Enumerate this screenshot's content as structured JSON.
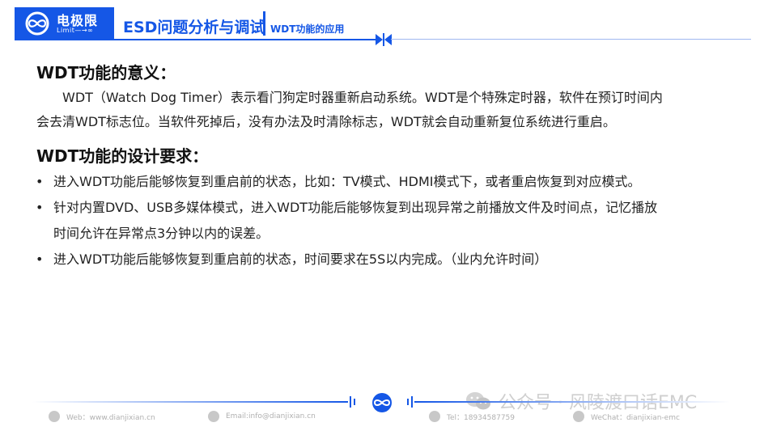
{
  "header": {
    "logo_cn": "电极限",
    "logo_en": "Limit—→∞",
    "title": "ESD问题分析与调试",
    "subtitle": "WDT功能的应用"
  },
  "content": {
    "heading1": "WDT功能的意义：",
    "para_line1": "WDT（Watch Dog Timer）表示看门狗定时器重新启动系统。WDT是个特殊定时器，软件在预订时间内",
    "para_line2": "会去清WDT标志位。当软件死掉后，没有办法及时清除标志，WDT就会自动重新复位系统进行重启。",
    "heading2": "WDT功能的设计要求：",
    "bullets": [
      {
        "dot": "•",
        "lines": [
          "进入WDT功能后能够恢复到重启前的状态，比如：TV模式、HDMI模式下，或者重启恢复到对应模式。"
        ]
      },
      {
        "dot": "•",
        "lines": [
          "针对内置DVD、USB多媒体模式，进入WDT功能后能够恢复到出现异常之前播放文件及时间点，记忆播放",
          "时间允许在异常点3分钟以内的误差。"
        ]
      },
      {
        "dot": "•",
        "lines": [
          "进入WDT功能后能够恢复到重启前的状态，时间要求在5S以内完成。（业内允许时间）"
        ]
      }
    ]
  },
  "footer": {
    "web": "Web：www.dianjixian.cn",
    "email": "Email:info@dianjixian.cn",
    "tel": "Tel：18934587759",
    "wechat": "WeChat：dianjixian-emc"
  },
  "watermark": "公众号 · 风陵渡口话EMC",
  "colors": {
    "brand": "#1557e6"
  }
}
